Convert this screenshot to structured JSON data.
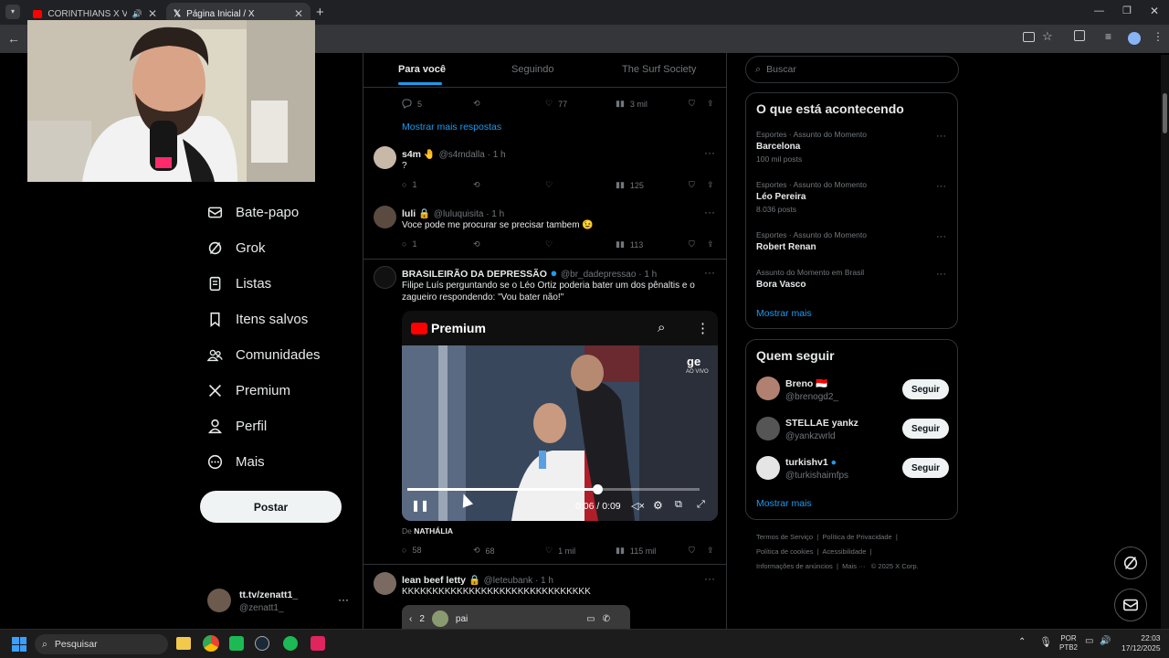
{
  "browser": {
    "tabs": [
      {
        "title": "CORINTHIANS X VASCO | A",
        "active": false
      },
      {
        "title": "Página Inicial / X",
        "active": true
      }
    ]
  },
  "nav": {
    "items": [
      "Bate-papo",
      "Grok",
      "Listas",
      "Itens salvos",
      "Comunidades",
      "Premium",
      "Perfil",
      "Mais"
    ],
    "post_button": "Postar",
    "account": {
      "name": "tt.tv/zenatt1_",
      "handle": "@zenatt1_"
    }
  },
  "feed_tabs": [
    "Para você",
    "Seguindo",
    "The Surf Society"
  ],
  "top_actions": {
    "replies": "5",
    "likes": "77",
    "views": "3 mil"
  },
  "show_more_replies": "Mostrar mais respostas",
  "tweets": [
    {
      "name": "s4m 🤚",
      "handle": "@s4mdalla · 1 h",
      "text": "?",
      "replies": "1",
      "likes": "",
      "views": "125"
    },
    {
      "name": "luli 🔒",
      "handle": "@luluquisita · 1 h",
      "text": "Voce pode me procurar se precisar tambem 😉",
      "replies": "1",
      "likes": "",
      "views": "113"
    },
    {
      "name": "BRASILEIRÃO DA DEPRESSÃO",
      "handle": "@br_dadepressao · 1 h",
      "text": "Filipe Luís perguntando se o Léo Ortiz poderia bater um dos pênaltis e o zagueiro respondendo: \"Vou bater não!\"",
      "replies": "58",
      "retweets": "68",
      "likes": "1 mil",
      "views": "115 mil"
    },
    {
      "name": "lean beef letty 🔒",
      "handle": "@leteubank · 1 h",
      "text": "KKKKKKKKKKKKKKKKKKKKKKKKKKKKKKK"
    }
  ],
  "video": {
    "brand": "Premium",
    "time": "0:06 / 0:09",
    "progress": 0.65,
    "corner_logo": "ge",
    "corner_sub": "AO VIVO",
    "source_prefix": "De",
    "source": "NATHÁLIA"
  },
  "dm_bar": {
    "count": "2",
    "name": "pai"
  },
  "search": {
    "placeholder": "Buscar"
  },
  "trends": {
    "title": "O que está acontecendo",
    "items": [
      {
        "category": "Esportes · Assunto do Momento",
        "name": "Barcelona",
        "count": "100 mil posts"
      },
      {
        "category": "Esportes · Assunto do Momento",
        "name": "Léo Pereira",
        "count": "8.036 posts"
      },
      {
        "category": "Esportes · Assunto do Momento",
        "name": "Robert Renan",
        "count": ""
      },
      {
        "category": "Assunto do Momento em Brasil",
        "name": "Bora Vasco",
        "count": ""
      }
    ],
    "show_more": "Mostrar mais"
  },
  "who_to_follow": {
    "title": "Quem seguir",
    "items": [
      {
        "name": "Breno 🇮🇩",
        "handle": "@brenogd2_"
      },
      {
        "name": "STELLAE yankz",
        "handle": "@yankzwrld"
      },
      {
        "name": "turkishv1",
        "handle": "@turkishaimfps"
      }
    ],
    "follow_label": "Seguir",
    "show_more": "Mostrar mais"
  },
  "footer": {
    "links": [
      "Termos de Serviço",
      "Política de Privacidade",
      "Política de cookies",
      "Acessibilidade",
      "Informações de anúncios",
      "Mais ···",
      "© 2025 X Corp."
    ]
  },
  "taskbar": {
    "search": "Pesquisar",
    "lang1": "POR",
    "lang2": "PTB2",
    "time": "22:03",
    "date": "17/12/2025"
  },
  "colors": {
    "accent": "#1d9bf0",
    "background": "#000000",
    "border": "#2f3336"
  }
}
